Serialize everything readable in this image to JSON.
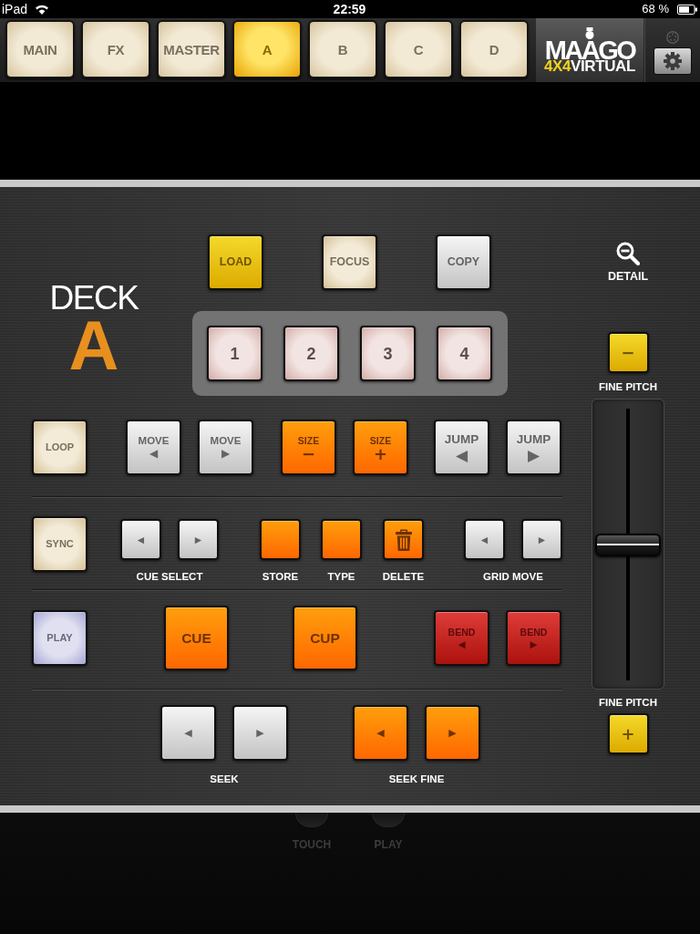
{
  "status_bar": {
    "carrier": "iPad",
    "time": "22:59",
    "battery": "68 %"
  },
  "tabs": [
    {
      "label": "MAIN",
      "selected": false
    },
    {
      "label": "FX",
      "selected": false
    },
    {
      "label": "MASTER",
      "selected": false
    },
    {
      "label": "A",
      "selected": true
    },
    {
      "label": "B",
      "selected": false
    },
    {
      "label": "C",
      "selected": false
    },
    {
      "label": "D",
      "selected": false
    }
  ],
  "logo": {
    "name": "MAAGO",
    "model": "4X4",
    "edition": "VIRTUAL"
  },
  "deck": {
    "title": "DECK",
    "letter": "A"
  },
  "top_buttons": [
    {
      "label": "LOAD",
      "kind": "yellow"
    },
    {
      "label": "FOCUS",
      "kind": "cream"
    },
    {
      "label": "COPY",
      "kind": "silver"
    }
  ],
  "hot_cues": [
    {
      "label": "1",
      "kind": "pink"
    },
    {
      "label": "2",
      "kind": "pink"
    },
    {
      "label": "3",
      "kind": "pink"
    },
    {
      "label": "4",
      "kind": "pink"
    }
  ],
  "button_rows": [
    {
      "groups": [
        {
          "buttons": [
            {
              "label": "LOOP",
              "kind": "cream"
            }
          ]
        },
        {
          "buttons": [
            {
              "label": "MOVE",
              "glyph": "◀",
              "kind": "silver"
            },
            {
              "label": "MOVE",
              "glyph": "▶",
              "kind": "silver"
            }
          ]
        },
        {
          "buttons": [
            {
              "label": "SIZE",
              "glyph": "−",
              "kind": "orange"
            },
            {
              "label": "SIZE",
              "glyph": "+",
              "kind": "orange"
            }
          ]
        },
        {
          "buttons": [
            {
              "label": "JUMP",
              "glyph": "◀",
              "kind": "silver"
            },
            {
              "label": "JUMP",
              "glyph": "▶",
              "kind": "silver"
            }
          ]
        }
      ]
    },
    {
      "groups": [
        {
          "buttons": [
            {
              "label": "SYNC",
              "kind": "cream"
            }
          ]
        },
        {
          "caption": "CUE SELECT",
          "buttons": [
            {
              "glyph": "◀",
              "kind": "silver"
            },
            {
              "glyph": "▶",
              "kind": "silver"
            }
          ]
        },
        {
          "caption": "STORE",
          "buttons": [
            {
              "kind": "orange"
            }
          ]
        },
        {
          "caption": "TYPE",
          "buttons": [
            {
              "kind": "orange"
            }
          ]
        },
        {
          "caption": "DELETE",
          "buttons": [
            {
              "kind": "trash"
            }
          ]
        },
        {
          "caption": "GRID MOVE",
          "buttons": [
            {
              "glyph": "◀",
              "kind": "silver"
            },
            {
              "glyph": "▶",
              "kind": "silver"
            }
          ]
        }
      ]
    },
    {
      "groups": [
        {
          "buttons": [
            {
              "label": "PLAY",
              "kind": "lavender"
            }
          ]
        },
        {
          "buttons": [
            {
              "label": "CUE",
              "kind": "orange"
            }
          ]
        },
        {
          "buttons": [
            {
              "label": "CUP",
              "kind": "orange"
            }
          ]
        },
        {
          "buttons": [
            {
              "label": "BEND",
              "glyph": "◀",
              "kind": "red"
            },
            {
              "label": "BEND",
              "glyph": "▶",
              "kind": "red"
            }
          ]
        }
      ]
    },
    {
      "groups": [
        {
          "caption": "SEEK",
          "buttons": [
            {
              "glyph": "◀",
              "kind": "silver"
            },
            {
              "glyph": "▶",
              "kind": "silver"
            }
          ]
        },
        {
          "caption": "SEEK FINE",
          "buttons": [
            {
              "glyph": "◀",
              "kind": "orange"
            },
            {
              "glyph": "▶",
              "kind": "orange"
            }
          ]
        }
      ]
    }
  ],
  "detail": {
    "label": "DETAIL"
  },
  "fine_pitch": {
    "minus": "−",
    "top_label": "FINE PITCH",
    "fader": {
      "level": 0.5
    },
    "bottom_label": "FINE PITCH",
    "plus": "+"
  },
  "footer_controls": [
    {
      "label": "TOUCH"
    },
    {
      "label": "PLAY"
    }
  ]
}
